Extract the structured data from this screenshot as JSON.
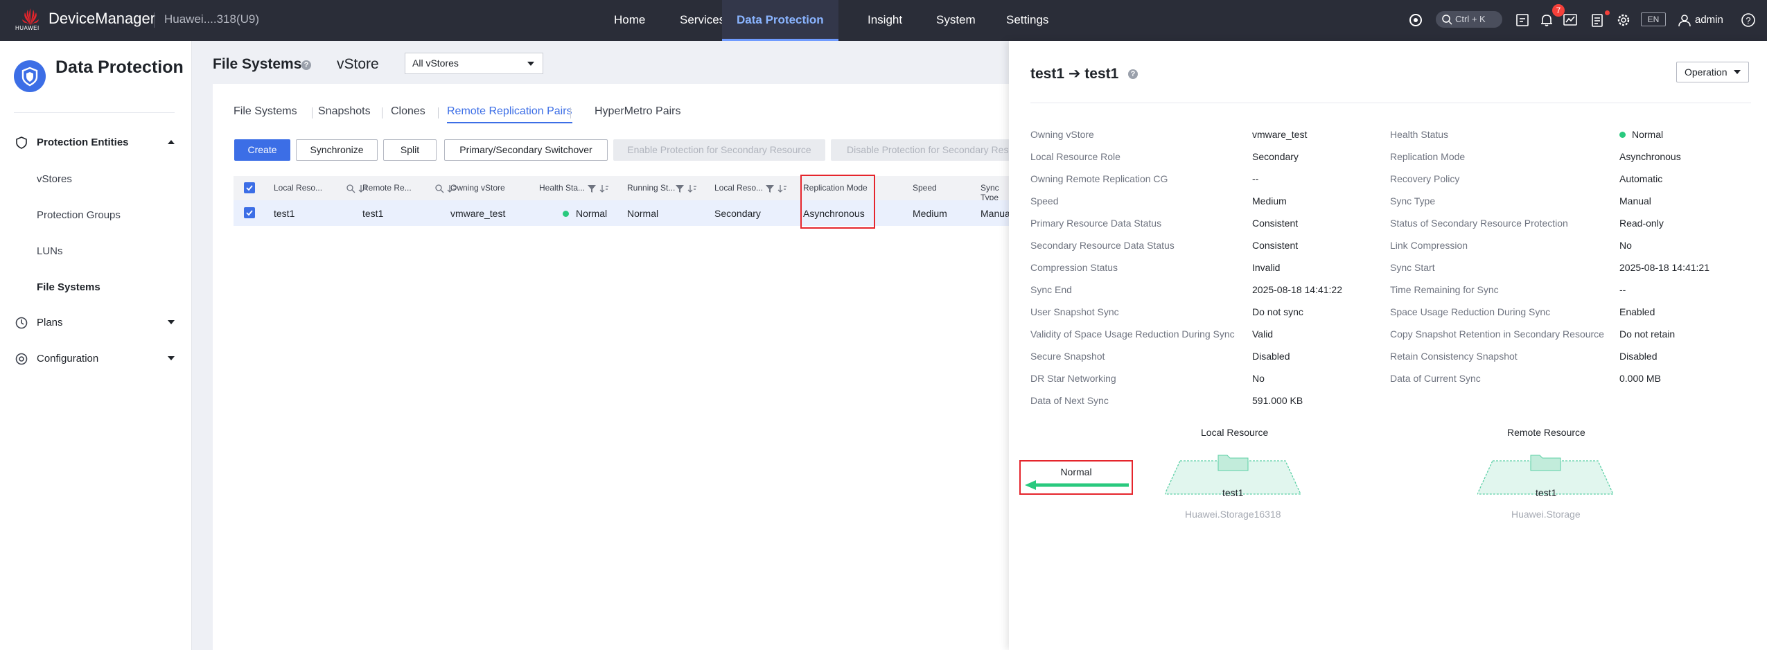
{
  "topbar": {
    "brand_text": "HUAWEI",
    "app_title": "DeviceManager",
    "device_name": "Huawei....318(U9)",
    "nav": [
      "Home",
      "Services",
      "Data Protection",
      "Insight",
      "System",
      "Settings"
    ],
    "active_nav": "Data Protection",
    "search_shortcut": "Ctrl + K",
    "notification_count": "7",
    "language": "EN",
    "user": "admin"
  },
  "sidebar": {
    "title": "Data Protection",
    "groups": [
      "Protection Entities",
      "Plans",
      "Configuration"
    ],
    "items": [
      "vStores",
      "Protection Groups",
      "LUNs",
      "File Systems"
    ],
    "active_item": "File Systems"
  },
  "main": {
    "page_title": "File Systems",
    "vstore_label": "vStore",
    "vstore_selected": "All vStores",
    "tabs": [
      "File Systems",
      "Snapshots",
      "Clones",
      "Remote Replication Pairs",
      "HyperMetro Pairs"
    ],
    "active_tab": "Remote Replication Pairs",
    "buttons": [
      "Create",
      "Synchronize",
      "Split",
      "Primary/Secondary Switchover",
      "Enable Protection for Secondary Resource",
      "Disable Protection for Secondary Res"
    ],
    "table": {
      "columns": [
        "Local Reso...",
        "Remote Re...",
        "Owning vStore",
        "Health Sta...",
        "Running St...",
        "Local Reso...",
        "Replication Mode",
        "Speed",
        "Sync Type"
      ],
      "rows": [
        [
          "test1",
          "test1",
          "vmware_test",
          "Normal",
          "Normal",
          "Secondary",
          "Asynchronous",
          "Medium",
          "Manual"
        ]
      ]
    }
  },
  "detail": {
    "title": "test1 ➔ test1",
    "operation_label": "Operation",
    "left": [
      {
        "label": "Owning vStore",
        "value": "vmware_test"
      },
      {
        "label": "Local Resource Role",
        "value": "Secondary"
      },
      {
        "label": "Owning Remote Replication CG",
        "value": "--"
      },
      {
        "label": "Speed",
        "value": "Medium"
      },
      {
        "label": "Primary Resource Data Status",
        "value": "Consistent"
      },
      {
        "label": "Secondary Resource Data Status",
        "value": "Consistent"
      },
      {
        "label": "Compression Status",
        "value": "Invalid"
      },
      {
        "label": "Sync End",
        "value": "2025-08-18 14:41:22"
      },
      {
        "label": "User Snapshot Sync",
        "value": "Do not sync"
      },
      {
        "label": "Validity of Space Usage Reduction During Sync",
        "value": "Valid"
      },
      {
        "label": "Secure Snapshot",
        "value": "Disabled"
      },
      {
        "label": "DR Star Networking",
        "value": "No"
      },
      {
        "label": "Data of Next Sync",
        "value": "591.000 KB"
      }
    ],
    "right": [
      {
        "label": "Health Status",
        "value": "Normal"
      },
      {
        "label": "Replication Mode",
        "value": "Asynchronous"
      },
      {
        "label": "Recovery Policy",
        "value": "Automatic"
      },
      {
        "label": "Sync Type",
        "value": "Manual"
      },
      {
        "label": "Status of Secondary Resource Protection",
        "value": "Read-only"
      },
      {
        "label": "Link Compression",
        "value": "No"
      },
      {
        "label": "Sync Start",
        "value": "2025-08-18 14:41:21"
      },
      {
        "label": "Time Remaining for Sync",
        "value": "--"
      },
      {
        "label": "Space Usage Reduction During Sync",
        "value": "Enabled"
      },
      {
        "label": "Copy Snapshot Retention in Secondary Resource",
        "value": "Do not retain"
      },
      {
        "label": "Retain Consistency Snapshot",
        "value": "Disabled"
      },
      {
        "label": "Data of Current Sync",
        "value": "0.000 MB"
      }
    ],
    "topology": {
      "local_heading": "Local Resource",
      "remote_heading": "Remote Resource",
      "local_name": "test1",
      "local_device": "Huawei.Storage16318",
      "remote_name": "test1",
      "remote_device": "Huawei.Storage",
      "link_status": "Normal"
    }
  },
  "colors": {
    "topbar": "#2a2d38",
    "accent": "#3c6ee6",
    "status_normal": "#29c97e",
    "highlight": "#e5252c"
  }
}
